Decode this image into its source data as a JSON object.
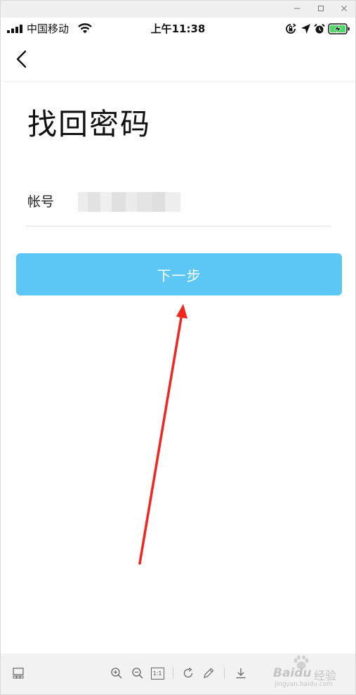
{
  "status_bar": {
    "carrier": "中国移动",
    "time": "上午11:38"
  },
  "page": {
    "title": "找回密码",
    "account_label": "帐号",
    "next_button": "下一步"
  },
  "viewer_toolbar": {
    "actual_size_label": "1:1"
  },
  "watermark": {
    "brand": "Baidu",
    "brand_cn": "经验",
    "site": "jingyan.baidu.com"
  },
  "colors": {
    "button": "#5cc7f5",
    "annotation_arrow": "#f0261f"
  }
}
